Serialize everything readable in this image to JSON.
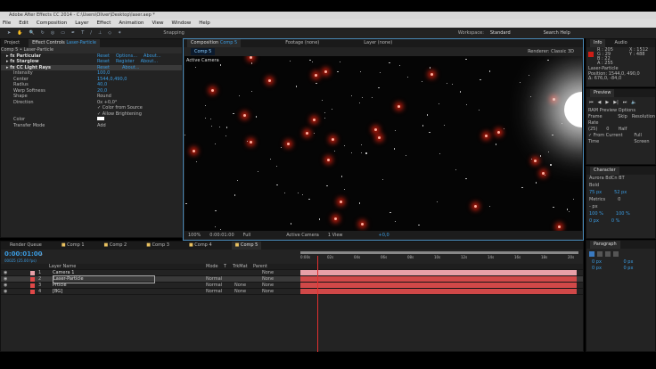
{
  "app": {
    "title": "Adobe After Effects CC 2014 - C:\\Users\\Oliver\\Desktop\\laser.aep *"
  },
  "menu": [
    "File",
    "Edit",
    "Composition",
    "Layer",
    "Effect",
    "Animation",
    "View",
    "Window",
    "Help"
  ],
  "toolbar": {
    "snapping": "Snapping",
    "workspace_label": "Workspace:",
    "workspace": "Standard",
    "search": "Search Help"
  },
  "left": {
    "tabs": [
      "Project",
      "Effect Controls",
      "Laser-Particle"
    ],
    "breadcrumb": "Comp 5 • Laser-Particle",
    "effects": [
      {
        "name": "Particular",
        "links": [
          "Reset",
          "Options...",
          "About..."
        ]
      },
      {
        "name": "Starglow",
        "links": [
          "Reset",
          "Register",
          "About..."
        ]
      },
      {
        "name": "CC Light Rays",
        "links": [
          "Reset",
          "",
          "About..."
        ]
      }
    ],
    "props": [
      [
        "Intensity",
        "100,0"
      ],
      [
        "Center",
        "1544,0,490,0"
      ],
      [
        "Radius",
        "40,0"
      ],
      [
        "Warp Softness",
        "20,0"
      ],
      [
        "Shape",
        "Round"
      ],
      [
        "Direction",
        "0x +0,0°"
      ],
      [
        "",
        "Color from Source"
      ],
      [
        "",
        "Allow Brightening"
      ],
      [
        "Color",
        ""
      ],
      [
        "Transfer Mode",
        "Add"
      ]
    ]
  },
  "comp": {
    "tabs": [
      "Composition",
      "Comp 5",
      "Footage (none)",
      "Layer (none)"
    ],
    "subtab": "Comp 5",
    "renderer_label": "Renderer:",
    "renderer": "Classic 3D",
    "camera_label": "Active Camera",
    "footer": {
      "zoom": "100%",
      "time": "0:00:01:00",
      "res": "Full",
      "view": "Active Camera",
      "views": "1 View",
      "offset": "+0,0"
    }
  },
  "info": {
    "tabs": [
      "Info",
      "Audio"
    ],
    "r": "R : 205",
    "g": "G : 29",
    "b": "B : 22",
    "a": "A : 255",
    "x": "X : 1512",
    "y": "Y : 488",
    "layer": "Laser-Particle",
    "pos": "Position: 1544,0, 490,0",
    "delta": "Δ: 676,0, -84,0"
  },
  "preview": {
    "tab": "Preview",
    "ram": "RAM Preview Options",
    "fr_label": "Frame Rate",
    "skip_label": "Skip",
    "res_label": "Resolution",
    "fr": "(25)",
    "skip": "0",
    "res": "Half",
    "from_current": "From Current Time",
    "full": "Full Screen"
  },
  "character": {
    "tab": "Character",
    "font": "Aurora BdCn BT",
    "style": "Bold",
    "size": "75 px",
    "kern": "Metrics",
    "lead": "52 px",
    "track": "0",
    "stroke": "- px",
    "vscale": "100 %",
    "hscale": "100 %",
    "baseline": "0 px",
    "tsume": "0 %"
  },
  "paragraph": {
    "tab": "Paragraph",
    "v": [
      "0 px",
      "0 px",
      "0 px",
      "0 px"
    ]
  },
  "timeline": {
    "tabs": [
      "Render Queue",
      "Comp 1",
      "Comp 2",
      "Comp 3",
      "Comp 4",
      "Comp 5"
    ],
    "timecode": "0:00:01:00",
    "frames": "00025 (25.00 fps)",
    "cols": [
      "Layer Name",
      "Mode",
      "T",
      "TrkMat",
      "Parent"
    ],
    "layers": [
      {
        "n": "1",
        "name": "Camera 1",
        "color": "#e8a0a8",
        "mode": "",
        "trk": "",
        "parent": "None"
      },
      {
        "n": "2",
        "name": "Laser-Particle",
        "color": "#e04848",
        "mode": "Normal",
        "trk": "",
        "parent": "None"
      },
      {
        "n": "3",
        "name": "Prticle",
        "color": "#e04848",
        "mode": "Normal",
        "trk": "None",
        "parent": "None"
      },
      {
        "n": "4",
        "name": "[BG]",
        "color": "#e04848",
        "mode": "Normal",
        "trk": "None",
        "parent": "None"
      }
    ],
    "ticks": [
      "0:00s",
      "02s",
      "04s",
      "06s",
      "08s",
      "10s",
      "12s",
      "14s",
      "16s",
      "18s",
      "20s"
    ]
  }
}
